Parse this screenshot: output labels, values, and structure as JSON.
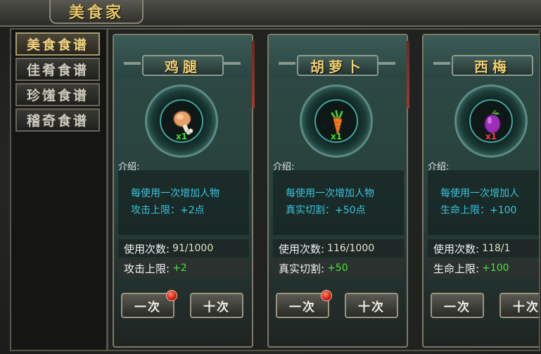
{
  "window": {
    "title": "美食家"
  },
  "sidebar": {
    "tabs": [
      {
        "label": "美食食谱",
        "active": true
      },
      {
        "label": "佳肴食谱",
        "active": false
      },
      {
        "label": "珍馐食谱",
        "active": false
      },
      {
        "label": "稽奇食谱",
        "active": false
      }
    ]
  },
  "common": {
    "intro_label": "介绍:",
    "btn_once": "一次",
    "btn_ten": "十次"
  },
  "cards": [
    {
      "name": "鸡腿",
      "icon": "chicken-leg-icon",
      "qty": "x1",
      "desc_line1": "每使用一次增加人物",
      "desc_line2": "攻击上限：+2点",
      "uses_label": "使用次数:",
      "uses_value": "91/1000",
      "stat_label": "攻击上限:",
      "stat_value": "+2",
      "has_notice": true
    },
    {
      "name": "胡萝卜",
      "icon": "carrot-icon",
      "qty": "x1",
      "desc_line1": "每使用一次增加人物",
      "desc_line2": "真实切割：+50点",
      "uses_label": "使用次数:",
      "uses_value": "116/1000",
      "stat_label": "真实切割:",
      "stat_value": "+50",
      "has_notice": true
    },
    {
      "name": "西梅",
      "icon": "plum-icon",
      "qty": "x1",
      "desc_line1": "每使用一次增加人",
      "desc_line2": "生命上限：+100",
      "uses_label": "使用次数:",
      "uses_value": "118/1",
      "stat_label": "生命上限:",
      "stat_value": "+100",
      "has_notice": false
    }
  ],
  "colors": {
    "title_gold": "#e9c76a",
    "desc_cyan": "#3bc2e0",
    "value_green": "#49e33a",
    "notice_red": "#d01a10"
  }
}
